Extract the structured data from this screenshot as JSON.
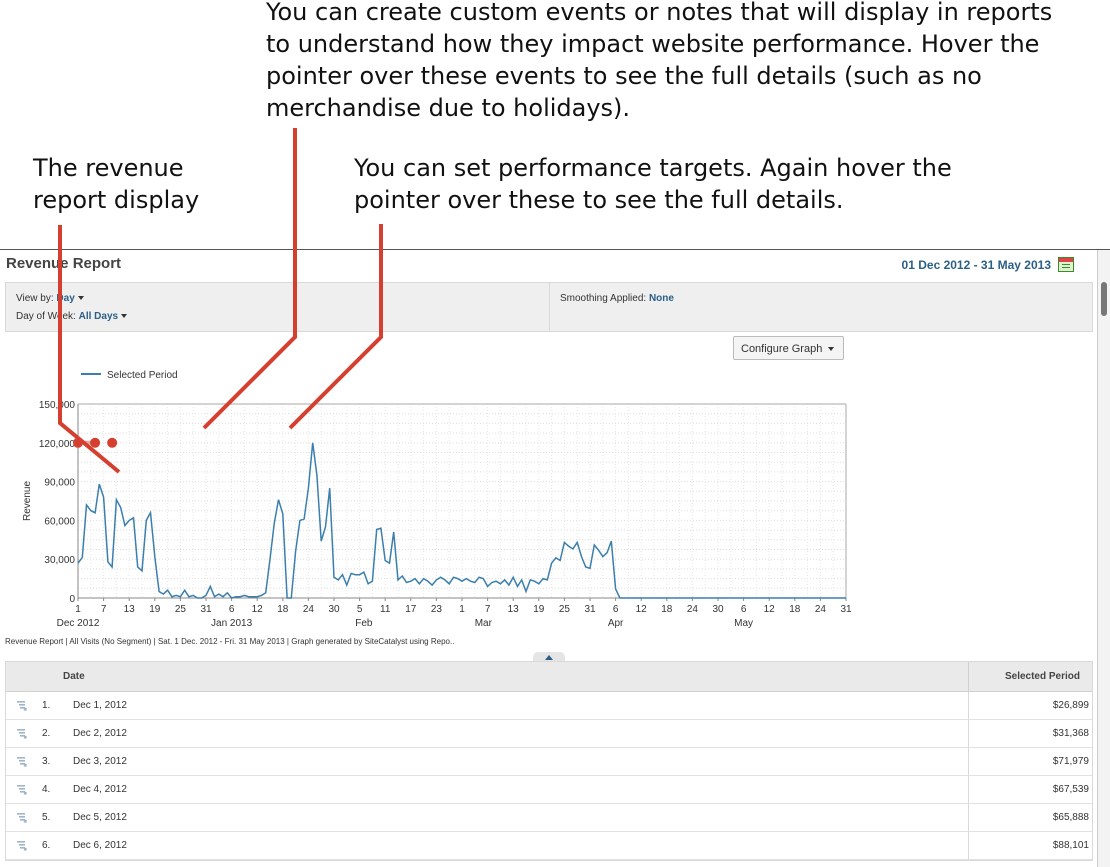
{
  "callouts": {
    "events": "You can create custom events or notes that will display in reports to understand how they impact website performance. Hover the pointer over these events to see the full details (such as no merchandise due to holidays).",
    "display": "The revenue report display",
    "targets": "You can set performance targets. Again hover the pointer over these to see the full details."
  },
  "header": {
    "title": "Revenue Report",
    "date_range": "01 Dec 2012 - 31 May 2013"
  },
  "options": {
    "view_by_label": "View by:",
    "view_by_value": "Day",
    "day_of_week_label": "Day of Week:",
    "day_of_week_value": "All Days",
    "smoothing_label": "Smoothing Applied:",
    "smoothing_value": "None"
  },
  "configure_graph_label": "Configure Graph",
  "colors": {
    "series": "#3a7fad",
    "callout_line": "#d43f2f",
    "target_line": "#eaa5a0",
    "link": "#2b5f86"
  },
  "chart_data": {
    "type": "line",
    "legend": "Selected Period",
    "legend_position": "top-left",
    "ylabel": "Revenue",
    "ylim": [
      0,
      150000
    ],
    "yticks": [
      "0",
      "30,000",
      "60,000",
      "90,000",
      "120,000",
      "150,000"
    ],
    "grid": true,
    "x_start": "2012-12-01",
    "x_ticks": [
      {
        "day": 1,
        "label": "1"
      },
      {
        "day": 7,
        "label": "7"
      },
      {
        "day": 13,
        "label": "13"
      },
      {
        "day": 19,
        "label": "19"
      },
      {
        "day": 25,
        "label": "25"
      },
      {
        "day": 31,
        "label": "31"
      },
      {
        "day": 37,
        "label": "6"
      },
      {
        "day": 43,
        "label": "12"
      },
      {
        "day": 49,
        "label": "18"
      },
      {
        "day": 55,
        "label": "24"
      },
      {
        "day": 61,
        "label": "30"
      },
      {
        "day": 67,
        "label": "5"
      },
      {
        "day": 73,
        "label": "11"
      },
      {
        "day": 79,
        "label": "17"
      },
      {
        "day": 85,
        "label": "23"
      },
      {
        "day": 91,
        "label": "1"
      },
      {
        "day": 97,
        "label": "7"
      },
      {
        "day": 103,
        "label": "13"
      },
      {
        "day": 109,
        "label": "19"
      },
      {
        "day": 115,
        "label": "25"
      },
      {
        "day": 121,
        "label": "31"
      },
      {
        "day": 127,
        "label": "6"
      },
      {
        "day": 133,
        "label": "12"
      },
      {
        "day": 139,
        "label": "18"
      },
      {
        "day": 145,
        "label": "24"
      },
      {
        "day": 151,
        "label": "30"
      },
      {
        "day": 157,
        "label": "6"
      },
      {
        "day": 163,
        "label": "12"
      },
      {
        "day": 169,
        "label": "18"
      },
      {
        "day": 175,
        "label": "24"
      },
      {
        "day": 181,
        "label": "31"
      }
    ],
    "month_labels": [
      {
        "day": 1,
        "label": "Dec 2012"
      },
      {
        "day": 37,
        "label": "Jan 2013"
      },
      {
        "day": 68,
        "label": "Feb"
      },
      {
        "day": 96,
        "label": "Mar"
      },
      {
        "day": 127,
        "label": "Apr"
      },
      {
        "day": 157,
        "label": "May"
      }
    ],
    "series": [
      {
        "name": "Selected Period",
        "points": [
          [
            1,
            26899
          ],
          [
            2,
            31368
          ],
          [
            3,
            71979
          ],
          [
            4,
            67539
          ],
          [
            5,
            65888
          ],
          [
            6,
            88101
          ],
          [
            7,
            78000
          ],
          [
            8,
            28000
          ],
          [
            9,
            24000
          ],
          [
            10,
            76000
          ],
          [
            11,
            70000
          ],
          [
            12,
            56000
          ],
          [
            13,
            60000
          ],
          [
            14,
            62000
          ],
          [
            15,
            24000
          ],
          [
            16,
            21000
          ],
          [
            17,
            60000
          ],
          [
            18,
            66000
          ],
          [
            19,
            32000
          ],
          [
            20,
            5000
          ],
          [
            21,
            3000
          ],
          [
            22,
            6000
          ],
          [
            23,
            1000
          ],
          [
            24,
            2000
          ],
          [
            25,
            1000
          ],
          [
            26,
            6000
          ],
          [
            27,
            1000
          ],
          [
            28,
            2000
          ],
          [
            29,
            0
          ],
          [
            30,
            0
          ],
          [
            31,
            2000
          ],
          [
            32,
            9000
          ],
          [
            33,
            1000
          ],
          [
            34,
            3000
          ],
          [
            35,
            1000
          ],
          [
            36,
            4000
          ],
          [
            37,
            0
          ],
          [
            38,
            1000
          ],
          [
            39,
            1000
          ],
          [
            40,
            2000
          ],
          [
            41,
            1000
          ],
          [
            42,
            1000
          ],
          [
            43,
            1000
          ],
          [
            44,
            2000
          ],
          [
            45,
            4000
          ],
          [
            46,
            30000
          ],
          [
            47,
            58000
          ],
          [
            48,
            76000
          ],
          [
            49,
            65000
          ],
          [
            50,
            0
          ],
          [
            51,
            0
          ],
          [
            52,
            36000
          ],
          [
            53,
            60000
          ],
          [
            54,
            61000
          ],
          [
            55,
            85000
          ],
          [
            56,
            120000
          ],
          [
            57,
            95000
          ],
          [
            58,
            44000
          ],
          [
            59,
            55000
          ],
          [
            60,
            85000
          ],
          [
            61,
            16000
          ],
          [
            62,
            14000
          ],
          [
            63,
            18000
          ],
          [
            64,
            10000
          ],
          [
            65,
            19000
          ],
          [
            66,
            18000
          ],
          [
            67,
            18000
          ],
          [
            68,
            20000
          ],
          [
            69,
            11000
          ],
          [
            70,
            13000
          ],
          [
            71,
            53000
          ],
          [
            72,
            54000
          ],
          [
            73,
            29000
          ],
          [
            74,
            27000
          ],
          [
            75,
            51000
          ],
          [
            76,
            14000
          ],
          [
            77,
            17000
          ],
          [
            78,
            12000
          ],
          [
            79,
            13000
          ],
          [
            80,
            15000
          ],
          [
            81,
            11000
          ],
          [
            82,
            15000
          ],
          [
            83,
            13000
          ],
          [
            84,
            10000
          ],
          [
            85,
            14000
          ],
          [
            86,
            16000
          ],
          [
            87,
            14000
          ],
          [
            88,
            11000
          ],
          [
            89,
            16000
          ],
          [
            90,
            15000
          ],
          [
            91,
            13000
          ],
          [
            92,
            15000
          ],
          [
            93,
            13000
          ],
          [
            94,
            12000
          ],
          [
            95,
            16000
          ],
          [
            96,
            15000
          ],
          [
            97,
            9000
          ],
          [
            98,
            12000
          ],
          [
            99,
            13000
          ],
          [
            100,
            11000
          ],
          [
            101,
            14000
          ],
          [
            102,
            10000
          ],
          [
            103,
            16000
          ],
          [
            104,
            9000
          ],
          [
            105,
            14000
          ],
          [
            106,
            5000
          ],
          [
            107,
            14000
          ],
          [
            108,
            13000
          ],
          [
            109,
            11000
          ],
          [
            110,
            15000
          ],
          [
            111,
            14000
          ],
          [
            112,
            27000
          ],
          [
            113,
            31000
          ],
          [
            114,
            29000
          ],
          [
            115,
            43000
          ],
          [
            116,
            40000
          ],
          [
            117,
            38000
          ],
          [
            118,
            43000
          ],
          [
            119,
            32000
          ],
          [
            120,
            24000
          ],
          [
            121,
            23000
          ],
          [
            122,
            41000
          ],
          [
            123,
            37000
          ],
          [
            124,
            32000
          ],
          [
            125,
            35000
          ],
          [
            126,
            44000
          ],
          [
            127,
            7000
          ],
          [
            128,
            0
          ],
          [
            129,
            0
          ],
          [
            130,
            0
          ],
          [
            131,
            0
          ],
          [
            181,
            0
          ]
        ]
      }
    ],
    "target": {
      "from": 1,
      "to": 5,
      "value": 120000
    },
    "events": [
      {
        "day": 1,
        "value": 120000
      },
      {
        "day": 5,
        "value": 120000
      },
      {
        "day": 9,
        "value": 120000
      }
    ]
  },
  "chart_footer": "Revenue Report | All Visits (No Segment) | Sat.  1 Dec. 2012 - Fri. 31 May 2013 | Graph generated by SiteCatalyst using Repo..",
  "table": {
    "headers": {
      "date": "Date",
      "value": "Selected Period"
    },
    "rows": [
      {
        "num": "1.",
        "date": "Dec 1, 2012",
        "value": "$26,899"
      },
      {
        "num": "2.",
        "date": "Dec 2, 2012",
        "value": "$31,368"
      },
      {
        "num": "3.",
        "date": "Dec 3, 2012",
        "value": "$71,979"
      },
      {
        "num": "4.",
        "date": "Dec 4, 2012",
        "value": "$67,539"
      },
      {
        "num": "5.",
        "date": "Dec 5, 2012",
        "value": "$65,888"
      },
      {
        "num": "6.",
        "date": "Dec 6, 2012",
        "value": "$88,101"
      }
    ]
  }
}
